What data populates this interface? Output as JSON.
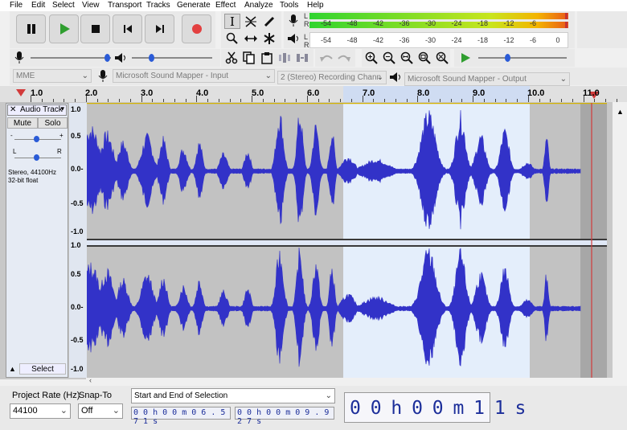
{
  "menu": [
    "File",
    "Edit",
    "Select",
    "View",
    "Transport",
    "Tracks",
    "Generate",
    "Effect",
    "Analyze",
    "Tools",
    "Help"
  ],
  "meters": {
    "record_ticks": [
      "-54",
      "-48",
      "-42",
      "-36",
      "-30",
      "-24",
      "-18",
      "-12",
      "-6"
    ],
    "play_ticks": [
      "-54",
      "-48",
      "-42",
      "-36",
      "-30",
      "-24",
      "-18",
      "-12",
      "-6",
      "0"
    ],
    "left_channel": "L",
    "right_channel": "R"
  },
  "device": {
    "host": "MME",
    "input": "Microsoft Sound Mapper - Input",
    "channels": "2 (Stereo) Recording Chann",
    "output": "Microsoft Sound Mapper - Output"
  },
  "ruler": [
    "1.0",
    "2.0",
    "3.0",
    "4.0",
    "5.0",
    "6.0",
    "7.0",
    "8.0",
    "9.0",
    "10.0",
    "11.0"
  ],
  "track": {
    "name": "Audio Track",
    "mute": "Mute",
    "solo": "Solo",
    "pan_left": "L",
    "pan_right": "R",
    "info_line1": "Stereo, 44100Hz",
    "info_line2": "32-bit float",
    "select": "Select",
    "scale_top": [
      "1.0",
      "0.5",
      "0.0-",
      "-0.5",
      "-1.0"
    ],
    "scale_bottom": [
      "1.0",
      "0.5",
      "0.0-",
      "-0.5",
      "-1.0"
    ]
  },
  "selection_toolbar": {
    "project_rate_label": "Project Rate (Hz)",
    "project_rate_value": "44100",
    "snap_to_label": "Snap-To",
    "snap_to_value": "Off",
    "selection_mode": "Start and End of Selection",
    "start_time": "0 0 h 0 0 m 0 6 . 5 7 1 s",
    "end_time": "0 0 h 0 0 m 0 9 . 9 2 7 s",
    "audio_position": "0 0 h 0 0 m 1 1 s"
  },
  "colors": {
    "waveform": "#3232c8",
    "selection_bg": "#e4eefb",
    "unselected_bg": "#c2c2c2",
    "focus_border": "#d4b200",
    "record_red": "#e34040",
    "play_green": "#2f9e2f"
  }
}
